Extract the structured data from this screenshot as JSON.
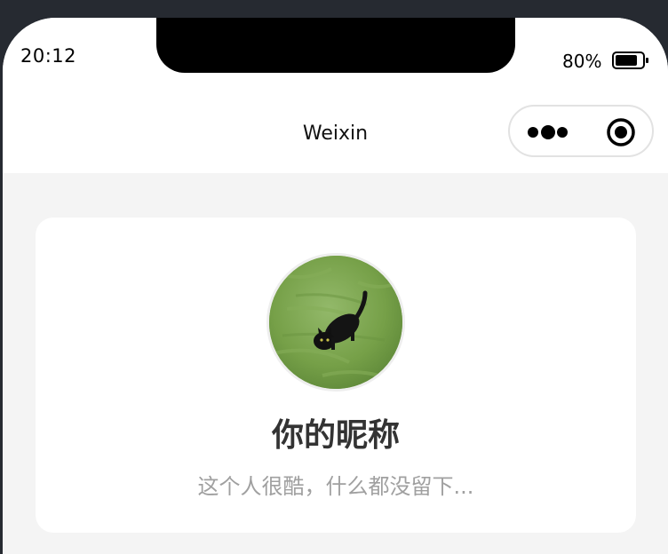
{
  "status_bar": {
    "time": "20:12",
    "battery_percent": "80%",
    "battery_level": 0.8
  },
  "nav": {
    "title": "Weixin",
    "more_icon": "more-dots-icon",
    "close_icon": "target-close-icon"
  },
  "profile": {
    "avatar_description": "black cat on green grass",
    "nickname": "你的昵称",
    "signature": "这个人很酷，什么都没留下..."
  },
  "colors": {
    "background": "#f4f4f4",
    "card": "#ffffff",
    "nickname": "#333333",
    "signature": "#a0a0a0"
  }
}
